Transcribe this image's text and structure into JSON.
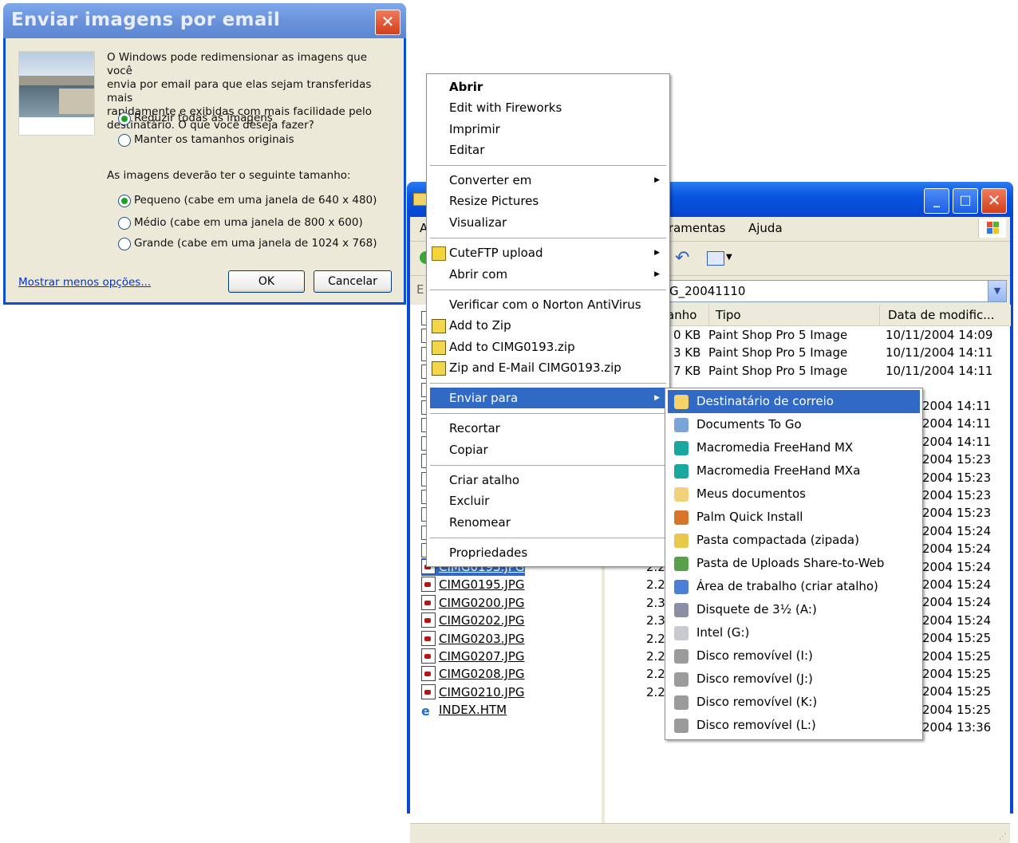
{
  "dialog": {
    "title": "Enviar imagens por email",
    "close_glyph": "✕",
    "intro_lines": [
      "O Windows pode redimensionar as imagens que você",
      "envia por email para que elas sejam transferidas mais",
      "rapidamente e exibidas com mais facilidade pelo",
      "destinatário. O que você deseja fazer?"
    ],
    "option_reduce": "Reduzir todas as imagens",
    "option_keep": "Manter os tamanhos originais",
    "size_prompt": "As imagens deverão ter o seguinte tamanho:",
    "size_small": "Pequeno (cabe em uma janela de 640 x 480)",
    "size_medium": "Médio (cabe em uma janela de 800 x 600)",
    "size_large": "Grande (cabe em uma janela de 1024 x 768)",
    "fewer_options_link": "Mostrar menos opções...",
    "ok_label": "OK",
    "cancel_label": "Cancelar"
  },
  "explorer": {
    "menu_partial": "rramentas",
    "menu_help": "Ajuda",
    "menu_partial_left": "A",
    "address_value": "G_20041110",
    "address_prefix": "E",
    "col_size": "anho",
    "col_type": "Tipo",
    "col_date": "Data de modific...",
    "top_rows": [
      {
        "size": "0 KB",
        "type": "Paint Shop Pro 5 Image",
        "date": "10/11/2004 14:09"
      },
      {
        "size": "3 KB",
        "type": "Paint Shop Pro 5 Image",
        "date": "10/11/2004 14:11"
      },
      {
        "size": "7 KB",
        "type": "Paint Shop Pro 5 Image",
        "date": "10/11/2004 14:11"
      }
    ],
    "right_dates": [
      "2004 14:11",
      "2004 14:11",
      "2004 14:11",
      "2004 15:23",
      "2004 15:23",
      "2004 15:23",
      "2004 15:23",
      "2004 15:24",
      "2004 15:24",
      "2004 15:24",
      "2004 15:24",
      "2004 15:24",
      "2004 15:24",
      "2004 15:25",
      "2004 15:25",
      "2004 15:25",
      "2004 15:25",
      "2004 15:25",
      "2004 13:36"
    ],
    "files": [
      {
        "name": "CIMG0193.JPG",
        "size": "2.2"
      },
      {
        "name": "CIMG0195.JPG",
        "size": "2.2"
      },
      {
        "name": "CIMG0200.JPG",
        "size": "2.3"
      },
      {
        "name": "CIMG0202.JPG",
        "size": "2.3"
      },
      {
        "name": "CIMG0203.JPG",
        "size": "2.2"
      },
      {
        "name": "CIMG0207.JPG",
        "size": "2.2"
      },
      {
        "name": "CIMG0208.JPG",
        "size": "2.2"
      },
      {
        "name": "CIMG0210.JPG",
        "size": "2.2"
      },
      {
        "name": "INDEX.HTM",
        "size": ""
      }
    ]
  },
  "context_menu": {
    "open": "Abrir",
    "edit_fireworks": "Edit with Fireworks",
    "print": "Imprimir",
    "edit": "Editar",
    "convert": "Converter em",
    "resize": "Resize Pictures",
    "preview": "Visualizar",
    "cuteftp": "CuteFTP upload",
    "open_with": "Abrir com",
    "norton": "Verificar com o Norton AntiVirus",
    "add_zip": "Add to Zip",
    "add_to_named_zip": "Add to CIMG0193.zip",
    "zip_email": "Zip and E-Mail CIMG0193.zip",
    "send_to": "Enviar para",
    "cut": "Recortar",
    "copy": "Copiar",
    "shortcut": "Criar atalho",
    "delete": "Excluir",
    "rename": "Renomear",
    "properties": "Propriedades",
    "arrow": "▶"
  },
  "send_to_menu": {
    "items": [
      {
        "label": "Destinatário de correio",
        "icon": "mail-recipient-icon",
        "color": "#f4d46a"
      },
      {
        "label": "Documents To Go",
        "icon": "documents-to-go-icon",
        "color": "#7aa5d8"
      },
      {
        "label": "Macromedia FreeHand MX",
        "icon": "freehand-icon",
        "color": "#1aa7a0"
      },
      {
        "label": "Macromedia FreeHand MXa",
        "icon": "freehand-icon",
        "color": "#1aa7a0"
      },
      {
        "label": "Meus documentos",
        "icon": "my-documents-icon",
        "color": "#f1d27a"
      },
      {
        "label": "Palm Quick Install",
        "icon": "palm-install-icon",
        "color": "#d9742b"
      },
      {
        "label": "Pasta compactada (zipada)",
        "icon": "zip-folder-icon",
        "color": "#e9c84a"
      },
      {
        "label": "Pasta de Uploads Share-to-Web",
        "icon": "web-upload-folder-icon",
        "color": "#5aa04a"
      },
      {
        "label": "Área de trabalho (criar atalho)",
        "icon": "desktop-icon",
        "color": "#4c7fd6"
      },
      {
        "label": "Disquete de 3½ (A:)",
        "icon": "floppy-icon",
        "color": "#8a8fa5"
      },
      {
        "label": "Intel (G:)",
        "icon": "cd-drive-icon",
        "color": "#c9c9d4"
      },
      {
        "label": "Disco removível (I:)",
        "icon": "removable-disk-icon",
        "color": "#9b9b9b"
      },
      {
        "label": "Disco removível (J:)",
        "icon": "removable-disk-icon",
        "color": "#9b9b9b"
      },
      {
        "label": "Disco removível (K:)",
        "icon": "removable-disk-icon",
        "color": "#9b9b9b"
      },
      {
        "label": "Disco removível (L:)",
        "icon": "removable-disk-icon",
        "color": "#9b9b9b"
      }
    ]
  }
}
